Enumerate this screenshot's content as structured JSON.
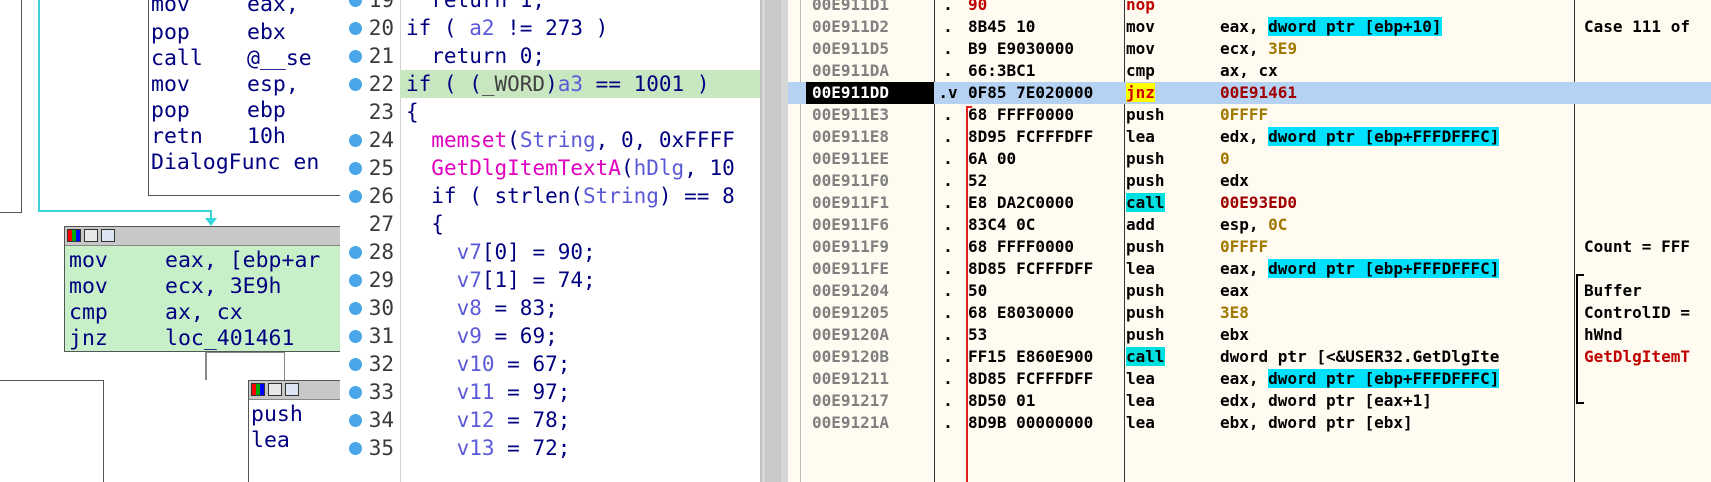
{
  "ida_graph": {
    "top_node": {
      "lines": [
        {
          "mn": "mov",
          "op": "eax,"
        },
        {
          "mn": "pop",
          "op": "ebx"
        },
        {
          "mn": "call",
          "op": "@__se"
        },
        {
          "mn": "mov",
          "op": "esp,"
        },
        {
          "mn": "pop",
          "op": "ebp"
        },
        {
          "mn": "retn",
          "op": "10h"
        },
        {
          "mn": "DialogFunc",
          "op": "en"
        }
      ]
    },
    "mid_node": {
      "lines": [
        {
          "mn": "mov",
          "op": "eax, [ebp+ar"
        },
        {
          "mn": "mov",
          "op": "ecx, 3E9h"
        },
        {
          "mn": "cmp",
          "op": "ax, cx"
        },
        {
          "mn": "jnz",
          "op": "loc_401461"
        }
      ]
    },
    "bottom_node": {
      "lines": [
        {
          "mn": "push",
          "op": ""
        },
        {
          "mn": "lea",
          "op": ""
        }
      ]
    }
  },
  "pseudocode": {
    "lines": [
      {
        "num": "19",
        "text": "  return 1;",
        "bp": true
      },
      {
        "num": "20",
        "text": "if ( a2 != 273 )",
        "bp": true
      },
      {
        "num": "21",
        "text": "  return 0;",
        "bp": true
      },
      {
        "num": "22",
        "text": "if ( (_WORD)a3 == 1001 )",
        "bp": true,
        "highlight": true
      },
      {
        "num": "23",
        "text": "{",
        "bp": false
      },
      {
        "num": "24",
        "text": "  memset(String, 0, 0xFFFF",
        "bp": true
      },
      {
        "num": "25",
        "text": "  GetDlgItemTextA(hDlg, 10",
        "bp": true
      },
      {
        "num": "26",
        "text": "  if ( strlen(String) == 8",
        "bp": true
      },
      {
        "num": "27",
        "text": "  {",
        "bp": false
      },
      {
        "num": "28",
        "text": "    v7[0] = 90;",
        "bp": true
      },
      {
        "num": "29",
        "text": "    v7[1] = 74;",
        "bp": true
      },
      {
        "num": "30",
        "text": "    v8 = 83;",
        "bp": true
      },
      {
        "num": "31",
        "text": "    v9 = 69;",
        "bp": true
      },
      {
        "num": "32",
        "text": "    v10 = 67;",
        "bp": true
      },
      {
        "num": "33",
        "text": "    v11 = 97;",
        "bp": true
      },
      {
        "num": "34",
        "text": "    v12 = 78;",
        "bp": true
      },
      {
        "num": "35",
        "text": "    v13 = 72;",
        "bp": true
      }
    ]
  },
  "debugger": {
    "rows": [
      {
        "addr": "00E911D1",
        "dot": ".",
        "bytes": "90",
        "mn": "nop",
        "ops": "",
        "comment": ""
      },
      {
        "addr": "00E911D2",
        "dot": ".",
        "bytes": "8B45 10",
        "mn": "mov",
        "ops": "eax, dword ptr [ebp+10]",
        "comment": "Case 111 of"
      },
      {
        "addr": "00E911D5",
        "dot": ".",
        "bytes": "B9 E9030000",
        "mn": "mov",
        "ops": "ecx, 3E9",
        "comment": ""
      },
      {
        "addr": "00E911DA",
        "dot": ".",
        "bytes": "66:3BC1",
        "mn": "cmp",
        "ops": "ax, cx",
        "comment": ""
      },
      {
        "addr": "00E911DD",
        "dot": ".v",
        "bytes": "0F85 7E020000",
        "mn": "jnz",
        "ops": "00E91461",
        "comment": "",
        "current": true
      },
      {
        "addr": "00E911E3",
        "dot": ".",
        "bytes": "68 FFFF0000",
        "mn": "push",
        "ops": "0FFFF",
        "comment": ""
      },
      {
        "addr": "00E911E8",
        "dot": ".",
        "bytes": "8D95 FCFFFDFF",
        "mn": "lea",
        "ops": "edx, dword ptr [ebp+FFFDFFFC]",
        "comment": ""
      },
      {
        "addr": "00E911EE",
        "dot": ".",
        "bytes": "6A 00",
        "mn": "push",
        "ops": "0",
        "comment": ""
      },
      {
        "addr": "00E911F0",
        "dot": ".",
        "bytes": "52",
        "mn": "push",
        "ops": "edx",
        "comment": ""
      },
      {
        "addr": "00E911F1",
        "dot": ".",
        "bytes": "E8 DA2C0000",
        "mn": "call",
        "ops": "00E93ED0",
        "comment": ""
      },
      {
        "addr": "00E911F6",
        "dot": ".",
        "bytes": "83C4 0C",
        "mn": "add",
        "ops": "esp, 0C",
        "comment": ""
      },
      {
        "addr": "00E911F9",
        "dot": ".",
        "bytes": "68 FFFF0000",
        "mn": "push",
        "ops": "0FFFF",
        "comment": "Count = FFF"
      },
      {
        "addr": "00E911FE",
        "dot": ".",
        "bytes": "8D85 FCFFFDFF",
        "mn": "lea",
        "ops": "eax, dword ptr [ebp+FFFDFFFC]",
        "comment": ""
      },
      {
        "addr": "00E91204",
        "dot": ".",
        "bytes": "50",
        "mn": "push",
        "ops": "eax",
        "comment": "Buffer"
      },
      {
        "addr": "00E91205",
        "dot": ".",
        "bytes": "68 E8030000",
        "mn": "push",
        "ops": "3E8",
        "comment": "ControlID ="
      },
      {
        "addr": "00E9120A",
        "dot": ".",
        "bytes": "53",
        "mn": "push",
        "ops": "ebx",
        "comment": "hWnd"
      },
      {
        "addr": "00E9120B",
        "dot": ".",
        "bytes": "FF15 E860E900",
        "mn": "call",
        "ops": "dword ptr [<&USER32.GetDlgIte",
        "comment": "GetDlgItemT"
      },
      {
        "addr": "00E91211",
        "dot": ".",
        "bytes": "8D85 FCFFFDFF",
        "mn": "lea",
        "ops": "eax, dword ptr [ebp+FFFDFFFC]",
        "comment": ""
      },
      {
        "addr": "00E91217",
        "dot": ".",
        "bytes": "8D50 01",
        "mn": "lea",
        "ops": "edx, dword ptr [eax+1]",
        "comment": ""
      },
      {
        "addr": "00E9121A",
        "dot": ".",
        "bytes": "8D9B 00000000",
        "mn": "lea",
        "ops": "ebx, dword ptr [ebx]",
        "comment": ""
      }
    ]
  },
  "colors": {
    "ida_bg": "#ffffff",
    "mid_node_bg": "#c8f0c8",
    "edge_cyan": "#37d6dc",
    "pseudo_highlight": "#c8e6c0",
    "bp_dot": "#4aa6e8",
    "dbg_bg": "#fffbf0",
    "dbg_current_row": "#b6d2f2",
    "dbg_call_bg": "#00e0e0",
    "dbg_jnz_bg": "#ffff00",
    "dbg_operand_hl": "#00e0ff"
  }
}
